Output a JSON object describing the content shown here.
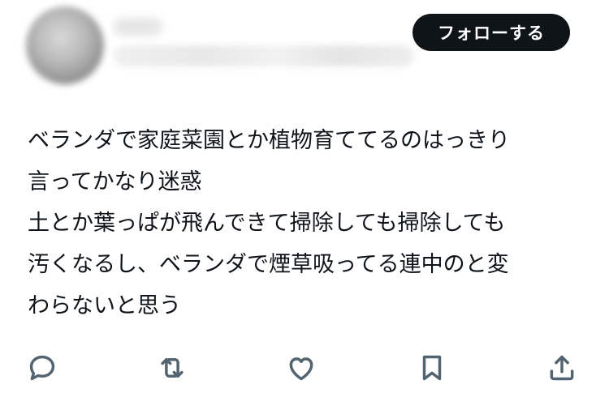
{
  "header": {
    "follow_label": "フォローする"
  },
  "tweet": {
    "lines": [
      "ベランダで家庭菜園とか植物育ててるのはっきり",
      "言ってかなり迷惑",
      "土とか葉っぱが飛んできて掃除しても掃除しても",
      "汚くなるし、ベランダで煙草吸ってる連中のと変",
      "わらないと思う"
    ]
  },
  "actions": {
    "icons": [
      "reply-icon",
      "retweet-icon",
      "like-icon",
      "bookmark-icon",
      "share-icon"
    ]
  },
  "colors": {
    "follow_bg": "#0f1419",
    "follow_text": "#ffffff",
    "text": "#0f1419",
    "icon": "#536471"
  }
}
